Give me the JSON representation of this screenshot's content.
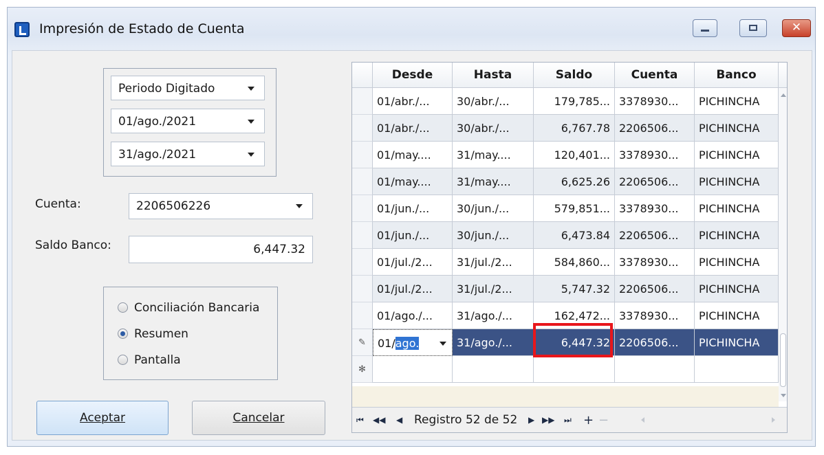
{
  "window": {
    "title": "Impresión de Estado de Cuenta"
  },
  "period": {
    "type": "Periodo Digitado",
    "from": "01/ago./2021",
    "to": "31/ago./2021"
  },
  "account": {
    "label": "Cuenta:",
    "value": "2206506226"
  },
  "balance": {
    "label": "Saldo Banco:",
    "value": "6,447.32"
  },
  "report_options": {
    "options": [
      "Conciliación Bancaria",
      "Resumen",
      "Pantalla"
    ],
    "selected": "Resumen"
  },
  "buttons": {
    "accept": "Aceptar",
    "cancel": "Cancelar"
  },
  "grid": {
    "columns": [
      "Desde",
      "Hasta",
      "Saldo",
      "Cuenta",
      "Banco"
    ],
    "rows": [
      [
        "01/abr./...",
        "30/abr./...",
        "179,785...",
        "3378930...",
        "PICHINCHA"
      ],
      [
        "01/abr./...",
        "30/abr./...",
        "6,767.78",
        "2206506...",
        "PICHINCHA"
      ],
      [
        "01/may....",
        "31/may....",
        "120,401...",
        "3378930...",
        "PICHINCHA"
      ],
      [
        "01/may....",
        "31/may....",
        "6,625.26",
        "2206506...",
        "PICHINCHA"
      ],
      [
        "01/jun./...",
        "30/jun./...",
        "579,851...",
        "3378930...",
        "PICHINCHA"
      ],
      [
        "01/jun./...",
        "30/jun./...",
        "6,473.84",
        "2206506...",
        "PICHINCHA"
      ],
      [
        "01/jul./2...",
        "31/jul./2...",
        "584,860...",
        "3378930...",
        "PICHINCHA"
      ],
      [
        "01/jul./2...",
        "31/jul./2...",
        "5,747.32",
        "2206506...",
        "PICHINCHA"
      ],
      [
        "01/ago./...",
        "31/ago./...",
        "162,472...",
        "3378930...",
        "PICHINCHA"
      ]
    ],
    "edit_row": {
      "desde_prefix": "01/",
      "desde_selected": "ago.",
      "hasta": "31/ago./...",
      "saldo": "6,447.32",
      "cuenta": "2206506...",
      "banco": "PICHINCHA"
    },
    "navigator": {
      "text": "Registro 52 de 52"
    }
  },
  "colors": {
    "selected_row": "#3b5386",
    "highlight_box": "#e8161b"
  }
}
